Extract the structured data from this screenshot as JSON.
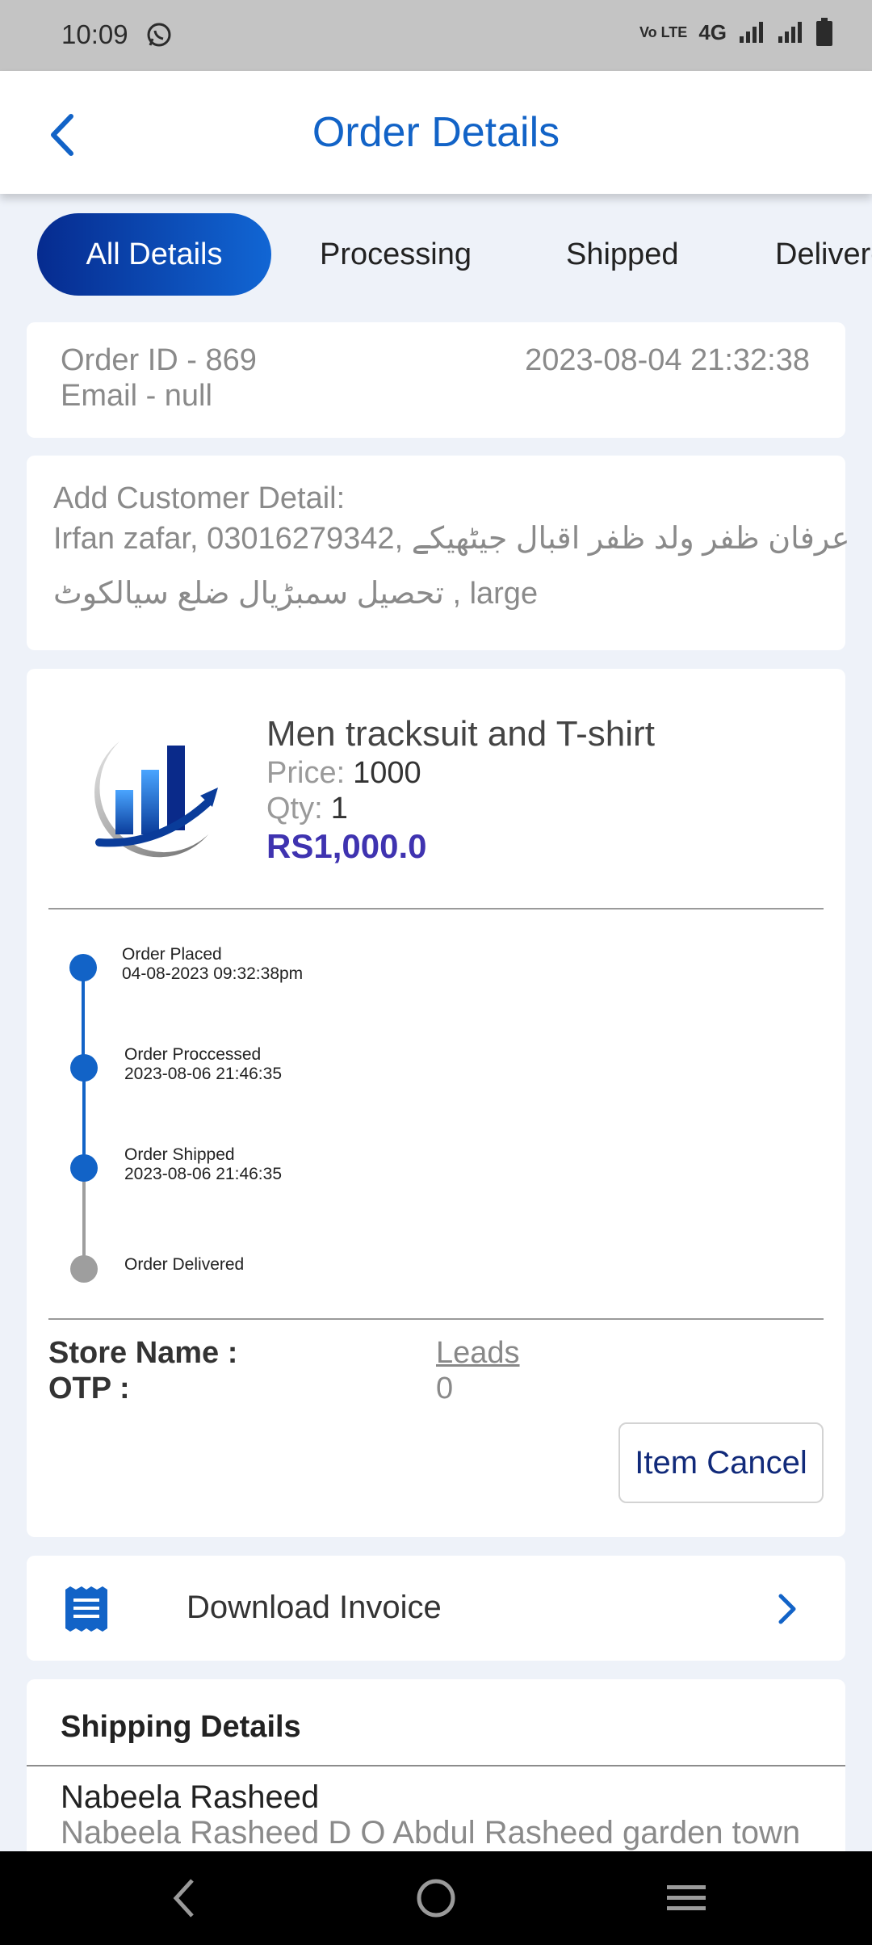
{
  "status_bar": {
    "time": "10:09",
    "network": "4G"
  },
  "header": {
    "title": "Order Details"
  },
  "tabs": [
    {
      "label": "All Details"
    },
    {
      "label": "Processing"
    },
    {
      "label": "Shipped"
    },
    {
      "label": "Delivered"
    }
  ],
  "order": {
    "id_line": "Order ID - 869",
    "email_line": "Email - null",
    "datetime": "2023-08-04 21:32:38"
  },
  "customer": {
    "heading": "Add Customer Detail:",
    "line1": "Irfan zafar, 03016279342, عرفان ظفر ولد ظفر اقبال جیٹھیکے",
    "line2": "تحصیل سمبڑیال ضلع سیالکوٹ , large"
  },
  "product": {
    "name": "Men tracksuit and T-shirt",
    "price_label": "Price:",
    "price_value": "1000",
    "qty_label": "Qty:",
    "qty_value": "1",
    "total": "RS1,000.0"
  },
  "timeline": [
    {
      "title": "Order Placed",
      "date": "04-08-2023 09:32:38pm",
      "done": true
    },
    {
      "title": "Order Proccessed",
      "date": "2023-08-06 21:46:35",
      "done": true
    },
    {
      "title": "Order Shipped",
      "date": "2023-08-06 21:46:35",
      "done": true
    },
    {
      "title": "Order Delivered",
      "date": "",
      "done": false
    }
  ],
  "store": {
    "store_label": "Store Name :",
    "store_value": "Leads",
    "otp_label": "OTP :",
    "otp_value": "0",
    "cancel_button": "Item Cancel"
  },
  "invoice": {
    "label": "Download Invoice"
  },
  "shipping": {
    "heading": "Shipping Details",
    "name": "Nabeela Rasheed",
    "address": "Nabeela Rasheed D O Abdul Rasheed garden town"
  },
  "colors": {
    "accent": "#1263c7",
    "tab_gradient_start": "#062b8f",
    "tab_gradient_end": "#1166d4",
    "total": "#3f33b0",
    "step_done": "#1263c7",
    "step_pending": "#9e9e9e"
  }
}
